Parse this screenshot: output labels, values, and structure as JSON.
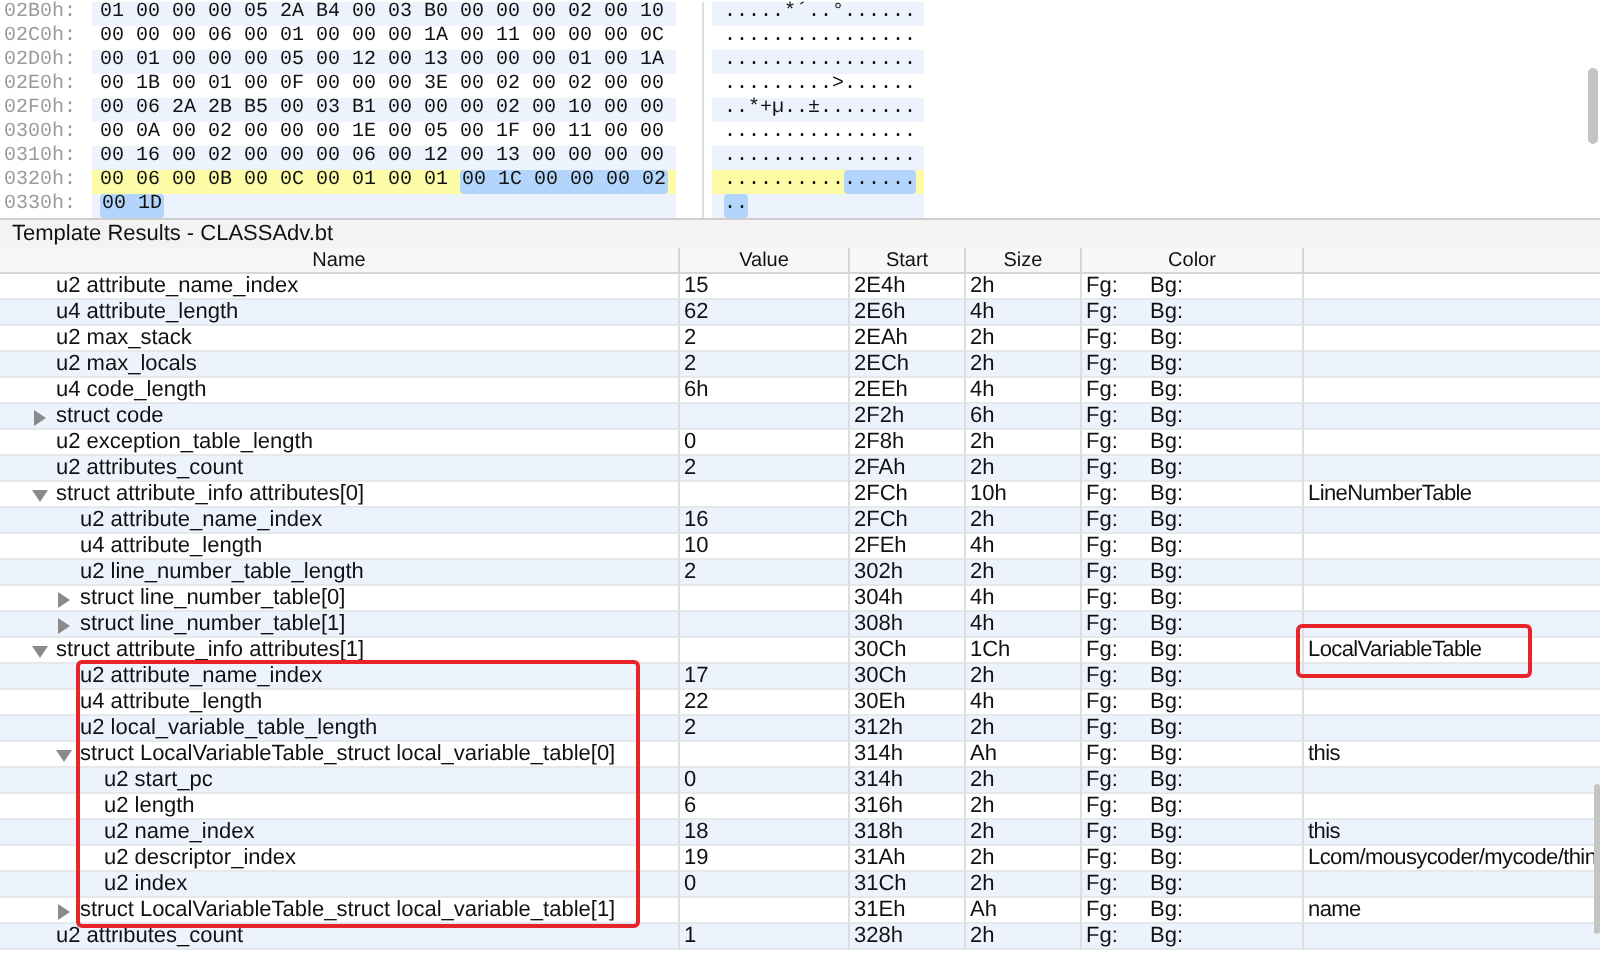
{
  "hex_view": {
    "rows": [
      {
        "offset": "02B0h:",
        "current": false,
        "hex": [
          {
            "text": "01 00 00 00 05 2A B4 00 03 B0 00 00 00 02 00 10",
            "selected": false
          }
        ],
        "ascii": [
          {
            "text": ".....*´..°......",
            "selected": false
          }
        ]
      },
      {
        "offset": "02C0h:",
        "current": false,
        "hex": [
          {
            "text": "00 00 00 06 00 01 00 00 00 1A 00 11 00 00 00 0C",
            "selected": false
          }
        ],
        "ascii": [
          {
            "text": "................",
            "selected": false
          }
        ]
      },
      {
        "offset": "02D0h:",
        "current": false,
        "hex": [
          {
            "text": "00 01 00 00 00 05 00 12 00 13 00 00 00 01 00 1A",
            "selected": false
          }
        ],
        "ascii": [
          {
            "text": "................",
            "selected": false
          }
        ]
      },
      {
        "offset": "02E0h:",
        "current": false,
        "hex": [
          {
            "text": "00 1B 00 01 00 0F 00 00 00 3E 00 02 00 02 00 00",
            "selected": false
          }
        ],
        "ascii": [
          {
            "text": ".........>......",
            "selected": false
          }
        ]
      },
      {
        "offset": "02F0h:",
        "current": false,
        "hex": [
          {
            "text": "00 06 2A 2B B5 00 03 B1 00 00 00 02 00 10 00 00",
            "selected": false
          }
        ],
        "ascii": [
          {
            "text": "..*+µ..±........",
            "selected": false
          }
        ]
      },
      {
        "offset": "0300h:",
        "current": false,
        "hex": [
          {
            "text": "00 0A 00 02 00 00 00 1E 00 05 00 1F 00 11 00 00",
            "selected": false
          }
        ],
        "ascii": [
          {
            "text": "................",
            "selected": false
          }
        ]
      },
      {
        "offset": "0310h:",
        "current": false,
        "hex": [
          {
            "text": "00 16 00 02 00 00 00 06 00 12 00 13 00 00 00 00",
            "selected": false
          }
        ],
        "ascii": [
          {
            "text": "................",
            "selected": false
          }
        ]
      },
      {
        "offset": "0320h:",
        "current": true,
        "hex": [
          {
            "text": "00 06 00 0B 00 0C 00 01 00 01",
            "selected": false
          },
          {
            "text": "00 1C 00 00 00 02",
            "selected": true
          }
        ],
        "ascii": [
          {
            "text": "..........",
            "selected": false
          },
          {
            "text": "......",
            "selected": true
          }
        ]
      },
      {
        "offset": "0330h:",
        "current": false,
        "hex": [
          {
            "text": "00 1D",
            "selected": true
          }
        ],
        "ascii": [
          {
            "text": "..",
            "selected": true
          }
        ]
      }
    ]
  },
  "template_results": {
    "title": "Template Results - CLASSAdv.bt",
    "columns": [
      "Name",
      "Value",
      "Start",
      "Size",
      "Color"
    ],
    "rows": [
      {
        "expanded": true,
        "children": [
          {
            "name": "u2 attribute_name_index",
            "value": "15",
            "start": "2E4h",
            "size": "2h",
            "fg": "Fg:",
            "bg": "Bg:"
          },
          {
            "name": "u4 attribute_length",
            "value": "62",
            "start": "2E6h",
            "size": "4h",
            "fg": "Fg:",
            "bg": "Bg:"
          },
          {
            "name": "u2 max_stack",
            "value": "2",
            "start": "2EAh",
            "size": "2h",
            "fg": "Fg:",
            "bg": "Bg:"
          },
          {
            "name": "u2 max_locals",
            "value": "2",
            "start": "2ECh",
            "size": "2h",
            "fg": "Fg:",
            "bg": "Bg:"
          },
          {
            "name": "u4 code_length",
            "value": "6h",
            "start": "2EEh",
            "size": "4h",
            "fg": "Fg:",
            "bg": "Bg:"
          },
          {
            "name": "struct code",
            "expanded": false,
            "start": "2F2h",
            "size": "6h",
            "fg": "Fg:",
            "bg": "Bg:"
          },
          {
            "name": "u2 exception_table_length",
            "value": "0",
            "start": "2F8h",
            "size": "2h",
            "fg": "Fg:",
            "bg": "Bg:"
          },
          {
            "name": "u2 attributes_count",
            "value": "2",
            "start": "2FAh",
            "size": "2h",
            "fg": "Fg:",
            "bg": "Bg:"
          },
          {
            "name": "struct attribute_info attributes[0]",
            "expanded": true,
            "start": "2FCh",
            "size": "10h",
            "fg": "Fg:",
            "bg": "Bg:",
            "comment": "LineNumberTable",
            "children": [
              {
                "name": "u2 attribute_name_index",
                "value": "16",
                "start": "2FCh",
                "size": "2h",
                "fg": "Fg:",
                "bg": "Bg:"
              },
              {
                "name": "u4 attribute_length",
                "value": "10",
                "start": "2FEh",
                "size": "4h",
                "fg": "Fg:",
                "bg": "Bg:"
              },
              {
                "name": "u2 line_number_table_length",
                "value": "2",
                "start": "302h",
                "size": "2h",
                "fg": "Fg:",
                "bg": "Bg:"
              },
              {
                "name": "struct line_number_table[0]",
                "expanded": false,
                "start": "304h",
                "size": "4h",
                "fg": "Fg:",
                "bg": "Bg:"
              },
              {
                "name": "struct line_number_table[1]",
                "expanded": false,
                "start": "308h",
                "size": "4h",
                "fg": "Fg:",
                "bg": "Bg:"
              }
            ]
          },
          {
            "name": "struct attribute_info attributes[1]",
            "expanded": true,
            "start": "30Ch",
            "size": "1Ch",
            "fg": "Fg:",
            "bg": "Bg:",
            "comment": "LocalVariableTable",
            "comment_boxed": true,
            "children_boxed": true,
            "children": [
              {
                "name": "u2 attribute_name_index",
                "value": "17",
                "start": "30Ch",
                "size": "2h",
                "fg": "Fg:",
                "bg": "Bg:"
              },
              {
                "name": "u4 attribute_length",
                "value": "22",
                "start": "30Eh",
                "size": "4h",
                "fg": "Fg:",
                "bg": "Bg:"
              },
              {
                "name": "u2 local_variable_table_length",
                "value": "2",
                "start": "312h",
                "size": "2h",
                "fg": "Fg:",
                "bg": "Bg:"
              },
              {
                "name": "struct LocalVariableTable_struct local_variable_table[0]",
                "expanded": true,
                "start": "314h",
                "size": "Ah",
                "fg": "Fg:",
                "bg": "Bg:",
                "comment": "this",
                "children": [
                  {
                    "name": "u2 start_pc",
                    "value": "0",
                    "start": "314h",
                    "size": "2h",
                    "fg": "Fg:",
                    "bg": "Bg:"
                  },
                  {
                    "name": "u2 length",
                    "value": "6",
                    "start": "316h",
                    "size": "2h",
                    "fg": "Fg:",
                    "bg": "Bg:"
                  },
                  {
                    "name": "u2 name_index",
                    "value": "18",
                    "start": "318h",
                    "size": "2h",
                    "fg": "Fg:",
                    "bg": "Bg:",
                    "comment": "this"
                  },
                  {
                    "name": "u2 descriptor_index",
                    "value": "19",
                    "start": "31Ah",
                    "size": "2h",
                    "fg": "Fg:",
                    "bg": "Bg:",
                    "comment": "Lcom/mousycoder/mycode/thin"
                  },
                  {
                    "name": "u2 index",
                    "value": "0",
                    "start": "31Ch",
                    "size": "2h",
                    "fg": "Fg:",
                    "bg": "Bg:"
                  }
                ]
              },
              {
                "name": "struct LocalVariableTable_struct local_variable_table[1]",
                "expanded": false,
                "start": "31Eh",
                "size": "Ah",
                "fg": "Fg:",
                "bg": "Bg:",
                "comment": "name"
              }
            ]
          }
        ]
      },
      {
        "name": "u2 attributes_count",
        "value": "1",
        "start": "328h",
        "size": "2h",
        "fg": "Fg:",
        "bg": "Bg:"
      }
    ]
  }
}
